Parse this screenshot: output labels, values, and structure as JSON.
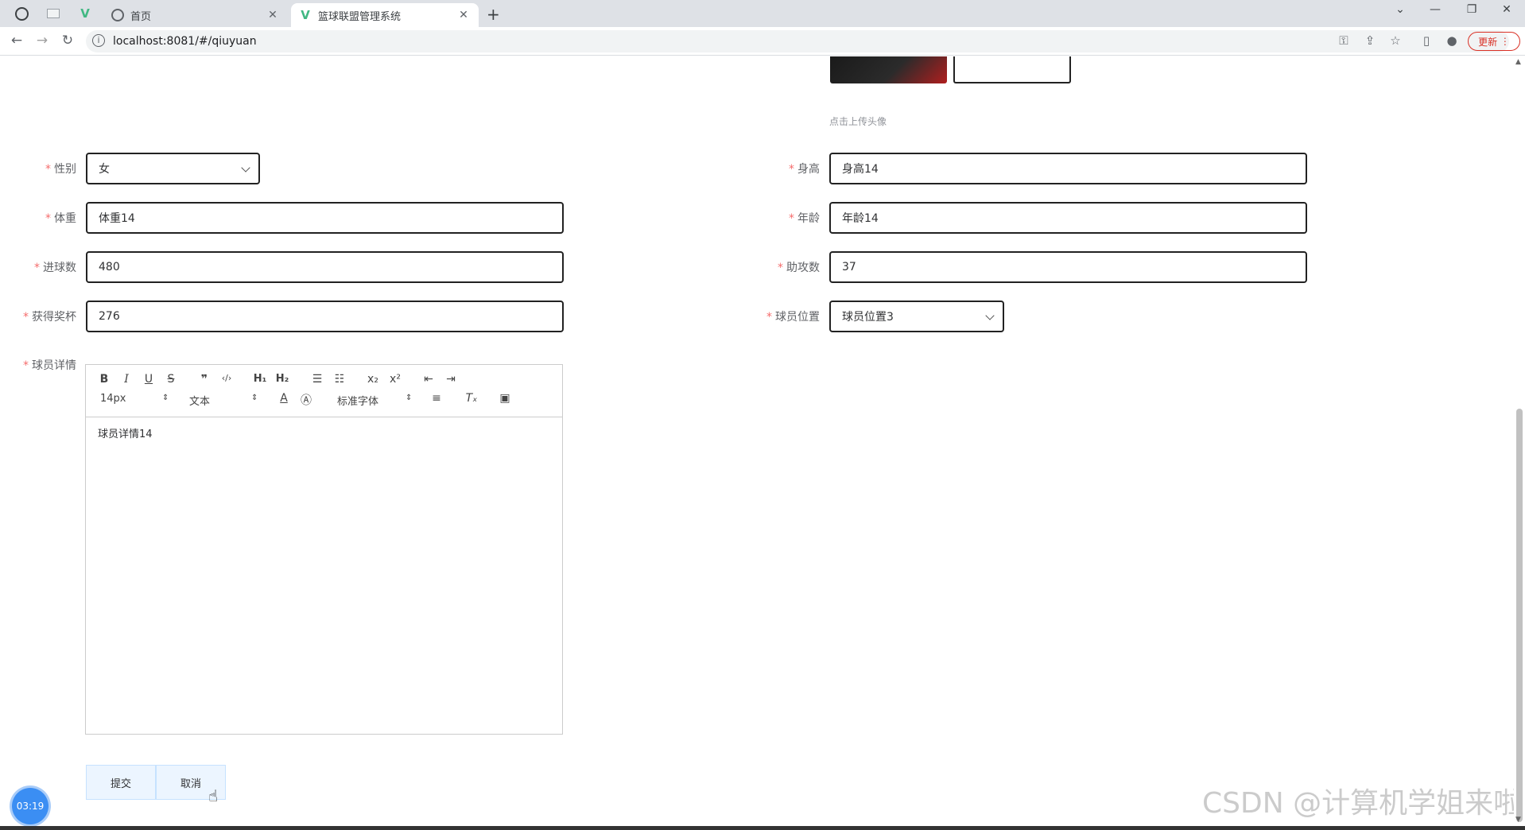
{
  "browser": {
    "tabs": [
      {
        "label": "首页",
        "active": false
      },
      {
        "label": "篮球联盟管理系统",
        "active": true
      }
    ],
    "url": "localhost:8081/#/qiuyuan",
    "update_label": "更新"
  },
  "avatar": {
    "hint": "点击上传头像"
  },
  "form": {
    "gender": {
      "label": "性别",
      "value": "女"
    },
    "height": {
      "label": "身高",
      "value": "身高14"
    },
    "weight": {
      "label": "体重",
      "value": "体重14"
    },
    "age": {
      "label": "年龄",
      "value": "年龄14"
    },
    "goals": {
      "label": "进球数",
      "value": "480"
    },
    "assists": {
      "label": "助攻数",
      "value": "37"
    },
    "trophies": {
      "label": "获得奖杯",
      "value": "276"
    },
    "position": {
      "label": "球员位置",
      "value": "球员位置3"
    },
    "details": {
      "label": "球员详情",
      "font_size": "14px",
      "header": "文本",
      "font": "标准字体",
      "content": "球员详情14"
    }
  },
  "buttons": {
    "submit": "提交",
    "cancel": "取消"
  },
  "overlay": {
    "timer": "03:19",
    "watermark": "CSDN @计算机学姐来啦"
  }
}
